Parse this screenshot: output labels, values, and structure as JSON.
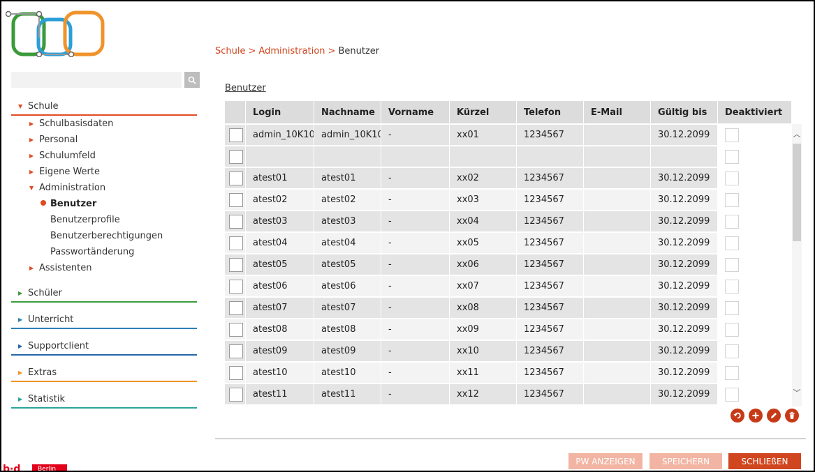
{
  "breadcrumb": {
    "item1": "Schule",
    "sep": ">",
    "item2": "Administration",
    "current": "Benutzer"
  },
  "search": {
    "placeholder": ""
  },
  "nav": {
    "schule": "Schule",
    "schulbasisdaten": "Schulbasisdaten",
    "personal": "Personal",
    "schulumfeld": "Schulumfeld",
    "eigene_werte": "Eigene Werte",
    "administration": "Administration",
    "benutzer": "Benutzer",
    "benutzerprofile": "Benutzerprofile",
    "benutzerberechtigungen": "Benutzerberechtigungen",
    "passwortaenderung": "Passwortänderung",
    "assistenten": "Assistenten",
    "schueler": "Schüler",
    "unterricht": "Unterricht",
    "supportclient": "Supportclient",
    "extras": "Extras",
    "statistik": "Statistik"
  },
  "section_title": "Benutzer",
  "table": {
    "headers": [
      "Login",
      "Nachname",
      "Vorname",
      "Kürzel",
      "Telefon",
      "E-Mail",
      "Gültig bis",
      "Deaktiviert"
    ],
    "rows": [
      [
        "admin_10K10",
        "admin_10K10",
        "-",
        "xx01",
        "1234567",
        "",
        "30.12.2099"
      ],
      [
        "",
        "",
        "",
        "",
        "",
        "",
        ""
      ],
      [
        "atest01",
        "atest01",
        "-",
        "xx02",
        "1234567",
        "",
        "30.12.2099"
      ],
      [
        "atest02",
        "atest02",
        "-",
        "xx03",
        "1234567",
        "",
        "30.12.2099"
      ],
      [
        "atest03",
        "atest03",
        "-",
        "xx04",
        "1234567",
        "",
        "30.12.2099"
      ],
      [
        "atest04",
        "atest04",
        "-",
        "xx05",
        "1234567",
        "",
        "30.12.2099"
      ],
      [
        "atest05",
        "atest05",
        "-",
        "xx06",
        "1234567",
        "",
        "30.12.2099"
      ],
      [
        "atest06",
        "atest06",
        "-",
        "xx07",
        "1234567",
        "",
        "30.12.2099"
      ],
      [
        "atest07",
        "atest07",
        "-",
        "xx08",
        "1234567",
        "",
        "30.12.2099"
      ],
      [
        "atest08",
        "atest08",
        "-",
        "xx09",
        "1234567",
        "",
        "30.12.2099"
      ],
      [
        "atest09",
        "atest09",
        "-",
        "xx10",
        "1234567",
        "",
        "30.12.2099"
      ],
      [
        "atest10",
        "atest10",
        "-",
        "xx11",
        "1234567",
        "",
        "30.12.2099"
      ],
      [
        "atest11",
        "atest11",
        "-",
        "xx12",
        "1234567",
        "",
        "30.12.2099"
      ]
    ]
  },
  "buttons": {
    "pw_anzeigen": "PW ANZEIGEN",
    "speichern": "SPEICHERN",
    "schliessen": "SCHLIEßEN"
  },
  "bottom_logo": {
    "text": "b·d",
    "box": "Berlin"
  },
  "colors": {
    "accent": "#d0461f",
    "accent_light": "#f2b5a3",
    "schule_line": "#e04b24",
    "schueler_line": "#3a9a3a",
    "unterricht_line": "#2c7fb8",
    "supportclient_line": "#2366a8",
    "extras_line": "#f0932b",
    "statistik_line": "#2aa39a"
  },
  "icons": [
    "search-icon",
    "undo-icon",
    "add-icon",
    "edit-icon",
    "delete-icon",
    "chevron-up-icon",
    "chevron-down-icon"
  ]
}
